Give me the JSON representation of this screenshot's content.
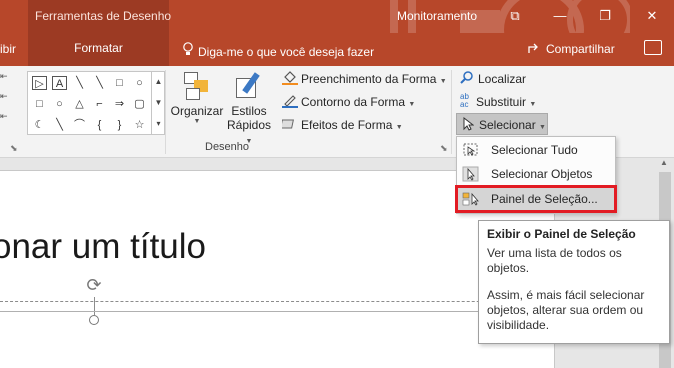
{
  "titlebar": {
    "context_group": "Ferramentas de Desenho",
    "app_title": "Monitoramento",
    "restore_glyph": "⧉",
    "minimize_glyph": "—",
    "maximize_glyph": "❐",
    "close_glyph": "✕"
  },
  "tabs": {
    "left_partial": "ibir",
    "active_tab": "Formatar",
    "tell_me": "Diga-me o que você deseja fazer",
    "share": "Compartilhar"
  },
  "ribbon": {
    "shapes_glyphs": [
      "▷",
      "A",
      "╲",
      "╲",
      "□",
      "○",
      "□",
      "○",
      "△",
      "⌐",
      "⇒",
      "▢",
      "☾",
      "╲",
      "⌒",
      "{",
      "}",
      "☆"
    ],
    "scroll_glyphs": [
      "▲",
      "▼",
      "▾"
    ],
    "organizar": "Organizar",
    "estilos_line1": "Estilos",
    "estilos_line2": "Rápidos",
    "fill": "Preenchimento da Forma",
    "outline": "Contorno da Forma",
    "effects": "Efeitos de Forma",
    "group_label": "Desenho",
    "find": "Localizar",
    "replace": "Substituir",
    "select": "Selecionar",
    "replace_icon_text": "ab ac"
  },
  "menu": {
    "items": [
      {
        "label": "Selecionar Tudo"
      },
      {
        "label": "Selecionar Objetos"
      },
      {
        "label": "Painel de Seleção..."
      }
    ]
  },
  "slide": {
    "title_text": "onar um título"
  },
  "tooltip": {
    "title": "Exibir o Painel de Seleção",
    "para1": "Ver uma lista de todos os objetos.",
    "para2": "Assim, é mais fácil selecionar objetos, alterar sua ordem ou visibilidade."
  },
  "colors": {
    "brand": "#b7472a",
    "brand_dark": "#9c3a23",
    "highlight_border": "#e21b23"
  }
}
